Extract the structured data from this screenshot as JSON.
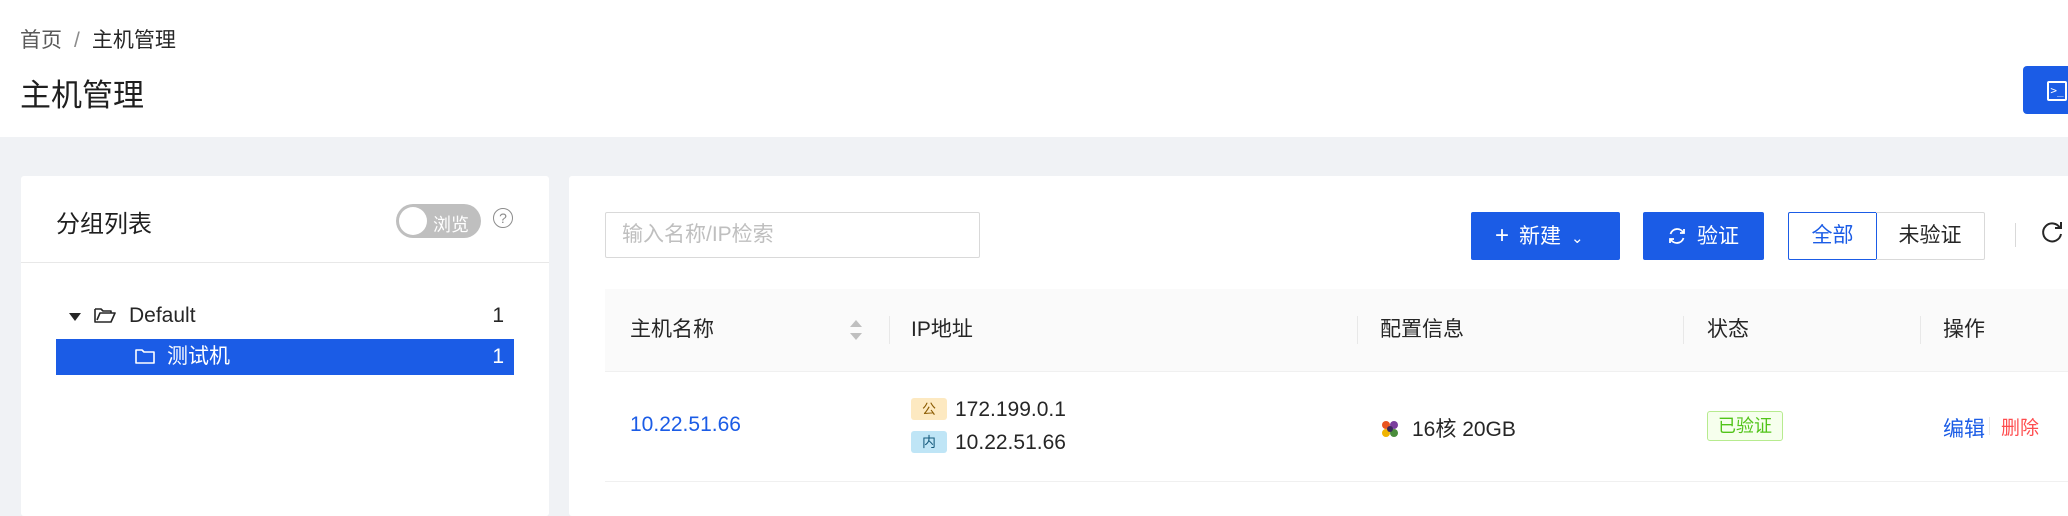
{
  "breadcrumb": {
    "home": "首页",
    "separator": "/",
    "current": "主机管理"
  },
  "page_title": "主机管理",
  "header": {
    "terminal_icon": "terminal-icon"
  },
  "group_panel": {
    "title": "分组列表",
    "toggle_label": "浏览",
    "toggle_on": false,
    "help_icon": "question-circle-icon",
    "tree": [
      {
        "label": "Default",
        "count": "1",
        "expanded": true,
        "icon": "folder-open-icon"
      },
      {
        "label": "测试机",
        "count": "1",
        "selected": true,
        "icon": "folder-icon"
      }
    ]
  },
  "toolbar": {
    "search_placeholder": "输入名称/IP检索",
    "search_value": "",
    "new_label": "新建",
    "verify_label": "验证",
    "filter_all": "全部",
    "filter_unverified": "未验证",
    "filter_selected": "全部"
  },
  "table": {
    "columns": [
      "主机名称",
      "IP地址",
      "配置信息",
      "状态",
      "操作"
    ],
    "rows": [
      {
        "host": "10.22.51.66",
        "public_tag": "公",
        "public_ip": "172.199.0.1",
        "private_tag": "内",
        "private_ip": "10.22.51.66",
        "config": "16核 20GB",
        "status": "已验证",
        "action_edit": "编辑",
        "action_delete": "删除"
      }
    ]
  },
  "colors": {
    "primary": "#1b5ce6",
    "danger": "#ff4d4f",
    "success": "#52c41a",
    "background": "#f0f2f5"
  }
}
